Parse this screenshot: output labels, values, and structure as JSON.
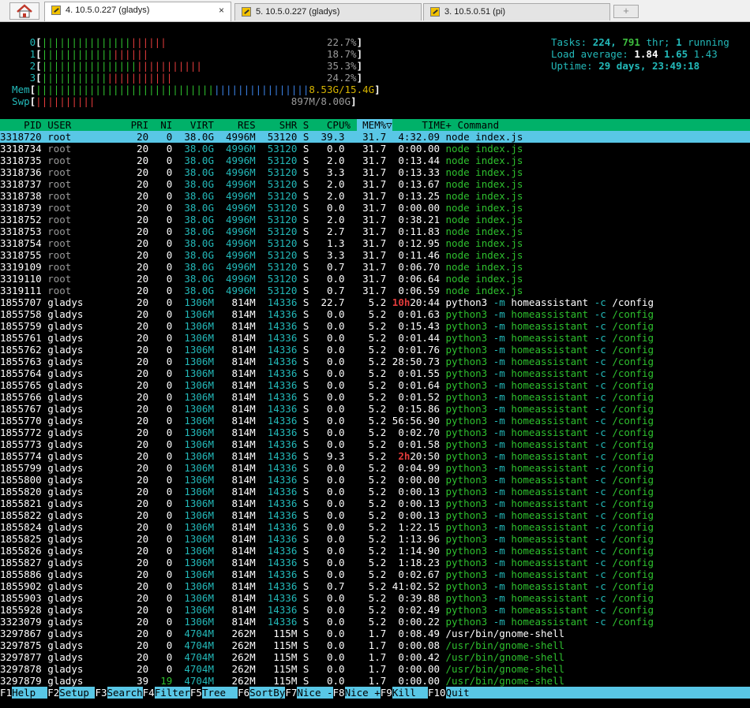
{
  "tabs": [
    {
      "label": "4. 10.5.0.227 (gladys)",
      "active": true
    },
    {
      "label": "5. 10.5.0.227 (gladys)",
      "active": false
    },
    {
      "label": "3. 10.5.0.51 (pi)",
      "active": false
    }
  ],
  "tab_close": "×",
  "new_tab": "+",
  "meters": {
    "cpus": [
      {
        "id": "0",
        "percent_text": "22.7%",
        "green": 15,
        "red": 6
      },
      {
        "id": "1",
        "percent_text": "18.7%",
        "green": 12,
        "red": 6
      },
      {
        "id": "2",
        "percent_text": "35.3%",
        "green": 16,
        "red": 11
      },
      {
        "id": "3",
        "percent_text": "24.2%",
        "green": 11,
        "red": 11
      }
    ],
    "mem": {
      "label": "Mem",
      "text": "8.53G/15.4G"
    },
    "swp": {
      "label": "Swp",
      "text": "897M/8.00G"
    }
  },
  "summary": {
    "tasks_label": "Tasks:",
    "tasks": "224,",
    "thr": "791",
    "thr_label": "thr;",
    "running": "1",
    "running_label": "running",
    "load_label": "Load average:",
    "load1": "1.84",
    "load5": "1.65",
    "load15": "1.43",
    "uptime_label": "Uptime:",
    "uptime": "29 days, 23:49:18"
  },
  "table": {
    "columns": [
      "PID",
      "USER",
      "PRI",
      "NI",
      "VIRT",
      "RES",
      "SHR",
      "S",
      "CPU%",
      "MEM%▽",
      "TIME+",
      "Command"
    ],
    "rows": [
      [
        "3318720",
        "root",
        "20",
        "0",
        "38.0G",
        "4996M",
        "53120",
        "S",
        "39.3",
        "31.7",
        "4:32.09",
        "node index.js"
      ],
      [
        "3318734",
        "root",
        "20",
        "0",
        "38.0G",
        "4996M",
        "53120",
        "S",
        "0.0",
        "31.7",
        "0:00.00",
        "node index.js"
      ],
      [
        "3318735",
        "root",
        "20",
        "0",
        "38.0G",
        "4996M",
        "53120",
        "S",
        "2.0",
        "31.7",
        "0:13.44",
        "node index.js"
      ],
      [
        "3318736",
        "root",
        "20",
        "0",
        "38.0G",
        "4996M",
        "53120",
        "S",
        "3.3",
        "31.7",
        "0:13.33",
        "node index.js"
      ],
      [
        "3318737",
        "root",
        "20",
        "0",
        "38.0G",
        "4996M",
        "53120",
        "S",
        "2.0",
        "31.7",
        "0:13.67",
        "node index.js"
      ],
      [
        "3318738",
        "root",
        "20",
        "0",
        "38.0G",
        "4996M",
        "53120",
        "S",
        "2.0",
        "31.7",
        "0:13.25",
        "node index.js"
      ],
      [
        "3318739",
        "root",
        "20",
        "0",
        "38.0G",
        "4996M",
        "53120",
        "S",
        "0.0",
        "31.7",
        "0:00.00",
        "node index.js"
      ],
      [
        "3318752",
        "root",
        "20",
        "0",
        "38.0G",
        "4996M",
        "53120",
        "S",
        "2.0",
        "31.7",
        "0:38.21",
        "node index.js"
      ],
      [
        "3318753",
        "root",
        "20",
        "0",
        "38.0G",
        "4996M",
        "53120",
        "S",
        "2.7",
        "31.7",
        "0:11.83",
        "node index.js"
      ],
      [
        "3318754",
        "root",
        "20",
        "0",
        "38.0G",
        "4996M",
        "53120",
        "S",
        "1.3",
        "31.7",
        "0:12.95",
        "node index.js"
      ],
      [
        "3318755",
        "root",
        "20",
        "0",
        "38.0G",
        "4996M",
        "53120",
        "S",
        "3.3",
        "31.7",
        "0:11.46",
        "node index.js"
      ],
      [
        "3319109",
        "root",
        "20",
        "0",
        "38.0G",
        "4996M",
        "53120",
        "S",
        "0.7",
        "31.7",
        "0:06.70",
        "node index.js"
      ],
      [
        "3319110",
        "root",
        "20",
        "0",
        "38.0G",
        "4996M",
        "53120",
        "S",
        "0.0",
        "31.7",
        "0:06.64",
        "node index.js"
      ],
      [
        "3319111",
        "root",
        "20",
        "0",
        "38.0G",
        "4996M",
        "53120",
        "S",
        "0.7",
        "31.7",
        "0:06.59",
        "node index.js"
      ],
      [
        "1855707",
        "gladys",
        "20",
        "0",
        "1306M",
        "814M",
        "14336",
        "S",
        "22.7",
        "5.2",
        "10h20:44",
        "python3 -m homeassistant -c /config"
      ],
      [
        "1855758",
        "gladys",
        "20",
        "0",
        "1306M",
        "814M",
        "14336",
        "S",
        "0.0",
        "5.2",
        "0:01.63",
        "python3 -m homeassistant -c /config"
      ],
      [
        "1855759",
        "gladys",
        "20",
        "0",
        "1306M",
        "814M",
        "14336",
        "S",
        "0.0",
        "5.2",
        "0:15.43",
        "python3 -m homeassistant -c /config"
      ],
      [
        "1855761",
        "gladys",
        "20",
        "0",
        "1306M",
        "814M",
        "14336",
        "S",
        "0.0",
        "5.2",
        "0:01.44",
        "python3 -m homeassistant -c /config"
      ],
      [
        "1855762",
        "gladys",
        "20",
        "0",
        "1306M",
        "814M",
        "14336",
        "S",
        "0.0",
        "5.2",
        "0:01.76",
        "python3 -m homeassistant -c /config"
      ],
      [
        "1855763",
        "gladys",
        "20",
        "0",
        "1306M",
        "814M",
        "14336",
        "S",
        "0.0",
        "5.2",
        "28:50.73",
        "python3 -m homeassistant -c /config"
      ],
      [
        "1855764",
        "gladys",
        "20",
        "0",
        "1306M",
        "814M",
        "14336",
        "S",
        "0.0",
        "5.2",
        "0:01.55",
        "python3 -m homeassistant -c /config"
      ],
      [
        "1855765",
        "gladys",
        "20",
        "0",
        "1306M",
        "814M",
        "14336",
        "S",
        "0.0",
        "5.2",
        "0:01.64",
        "python3 -m homeassistant -c /config"
      ],
      [
        "1855766",
        "gladys",
        "20",
        "0",
        "1306M",
        "814M",
        "14336",
        "S",
        "0.0",
        "5.2",
        "0:01.52",
        "python3 -m homeassistant -c /config"
      ],
      [
        "1855767",
        "gladys",
        "20",
        "0",
        "1306M",
        "814M",
        "14336",
        "S",
        "0.0",
        "5.2",
        "0:15.86",
        "python3 -m homeassistant -c /config"
      ],
      [
        "1855770",
        "gladys",
        "20",
        "0",
        "1306M",
        "814M",
        "14336",
        "S",
        "0.0",
        "5.2",
        "56:56.90",
        "python3 -m homeassistant -c /config"
      ],
      [
        "1855772",
        "gladys",
        "20",
        "0",
        "1306M",
        "814M",
        "14336",
        "S",
        "0.0",
        "5.2",
        "0:02.70",
        "python3 -m homeassistant -c /config"
      ],
      [
        "1855773",
        "gladys",
        "20",
        "0",
        "1306M",
        "814M",
        "14336",
        "S",
        "0.0",
        "5.2",
        "0:01.58",
        "python3 -m homeassistant -c /config"
      ],
      [
        "1855774",
        "gladys",
        "20",
        "0",
        "1306M",
        "814M",
        "14336",
        "S",
        "9.3",
        "5.2",
        "2h20:50",
        "python3 -m homeassistant -c /config"
      ],
      [
        "1855799",
        "gladys",
        "20",
        "0",
        "1306M",
        "814M",
        "14336",
        "S",
        "0.0",
        "5.2",
        "0:04.99",
        "python3 -m homeassistant -c /config"
      ],
      [
        "1855800",
        "gladys",
        "20",
        "0",
        "1306M",
        "814M",
        "14336",
        "S",
        "0.0",
        "5.2",
        "0:00.00",
        "python3 -m homeassistant -c /config"
      ],
      [
        "1855820",
        "gladys",
        "20",
        "0",
        "1306M",
        "814M",
        "14336",
        "S",
        "0.0",
        "5.2",
        "0:00.13",
        "python3 -m homeassistant -c /config"
      ],
      [
        "1855821",
        "gladys",
        "20",
        "0",
        "1306M",
        "814M",
        "14336",
        "S",
        "0.0",
        "5.2",
        "0:00.13",
        "python3 -m homeassistant -c /config"
      ],
      [
        "1855822",
        "gladys",
        "20",
        "0",
        "1306M",
        "814M",
        "14336",
        "S",
        "0.0",
        "5.2",
        "0:00.13",
        "python3 -m homeassistant -c /config"
      ],
      [
        "1855824",
        "gladys",
        "20",
        "0",
        "1306M",
        "814M",
        "14336",
        "S",
        "0.0",
        "5.2",
        "1:22.15",
        "python3 -m homeassistant -c /config"
      ],
      [
        "1855825",
        "gladys",
        "20",
        "0",
        "1306M",
        "814M",
        "14336",
        "S",
        "0.0",
        "5.2",
        "1:13.96",
        "python3 -m homeassistant -c /config"
      ],
      [
        "1855826",
        "gladys",
        "20",
        "0",
        "1306M",
        "814M",
        "14336",
        "S",
        "0.0",
        "5.2",
        "1:14.90",
        "python3 -m homeassistant -c /config"
      ],
      [
        "1855827",
        "gladys",
        "20",
        "0",
        "1306M",
        "814M",
        "14336",
        "S",
        "0.0",
        "5.2",
        "1:18.23",
        "python3 -m homeassistant -c /config"
      ],
      [
        "1855886",
        "gladys",
        "20",
        "0",
        "1306M",
        "814M",
        "14336",
        "S",
        "0.0",
        "5.2",
        "0:02.67",
        "python3 -m homeassistant -c /config"
      ],
      [
        "1855902",
        "gladys",
        "20",
        "0",
        "1306M",
        "814M",
        "14336",
        "S",
        "0.7",
        "5.2",
        "41:02.52",
        "python3 -m homeassistant -c /config"
      ],
      [
        "1855903",
        "gladys",
        "20",
        "0",
        "1306M",
        "814M",
        "14336",
        "S",
        "0.0",
        "5.2",
        "0:39.88",
        "python3 -m homeassistant -c /config"
      ],
      [
        "1855928",
        "gladys",
        "20",
        "0",
        "1306M",
        "814M",
        "14336",
        "S",
        "0.0",
        "5.2",
        "0:02.49",
        "python3 -m homeassistant -c /config"
      ],
      [
        "3323079",
        "gladys",
        "20",
        "0",
        "1306M",
        "814M",
        "14336",
        "S",
        "0.0",
        "5.2",
        "0:00.22",
        "python3 -m homeassistant -c /config"
      ],
      [
        "3297867",
        "gladys",
        "20",
        "0",
        "4704M",
        "262M",
        "115M",
        "S",
        "0.0",
        "1.7",
        "0:08.49",
        "/usr/bin/gnome-shell"
      ],
      [
        "3297875",
        "gladys",
        "20",
        "0",
        "4704M",
        "262M",
        "115M",
        "S",
        "0.0",
        "1.7",
        "0:00.08",
        "/usr/bin/gnome-shell"
      ],
      [
        "3297877",
        "gladys",
        "20",
        "0",
        "4704M",
        "262M",
        "115M",
        "S",
        "0.0",
        "1.7",
        "0:00.42",
        "/usr/bin/gnome-shell"
      ],
      [
        "3297878",
        "gladys",
        "20",
        "0",
        "4704M",
        "262M",
        "115M",
        "S",
        "0.0",
        "1.7",
        "0:00.00",
        "/usr/bin/gnome-shell"
      ],
      [
        "3297879",
        "gladys",
        "39",
        "19",
        "4704M",
        "262M",
        "115M",
        "S",
        "0.0",
        "1.7",
        "0:00.00",
        "/usr/bin/gnome-shell"
      ]
    ]
  },
  "fkeys": [
    {
      "key": "F1",
      "label": "Help  "
    },
    {
      "key": "F2",
      "label": "Setup "
    },
    {
      "key": "F3",
      "label": "Search"
    },
    {
      "key": "F4",
      "label": "Filter"
    },
    {
      "key": "F5",
      "label": "Tree  "
    },
    {
      "key": "F6",
      "label": "SortBy"
    },
    {
      "key": "F7",
      "label": "Nice -"
    },
    {
      "key": "F8",
      "label": "Nice +"
    },
    {
      "key": "F9",
      "label": "Kill  "
    },
    {
      "key": "F10",
      "label": "Quit"
    }
  ],
  "colors": {
    "green": "#2ec02e",
    "red": "#e23b3b",
    "blue": "#3b82e6",
    "cyan": "#23b9b9",
    "yellow": "#d6b400",
    "thread_green": "#3fbf3f",
    "header_bg": "#00b169",
    "selected_bg": "#59c7e6"
  }
}
